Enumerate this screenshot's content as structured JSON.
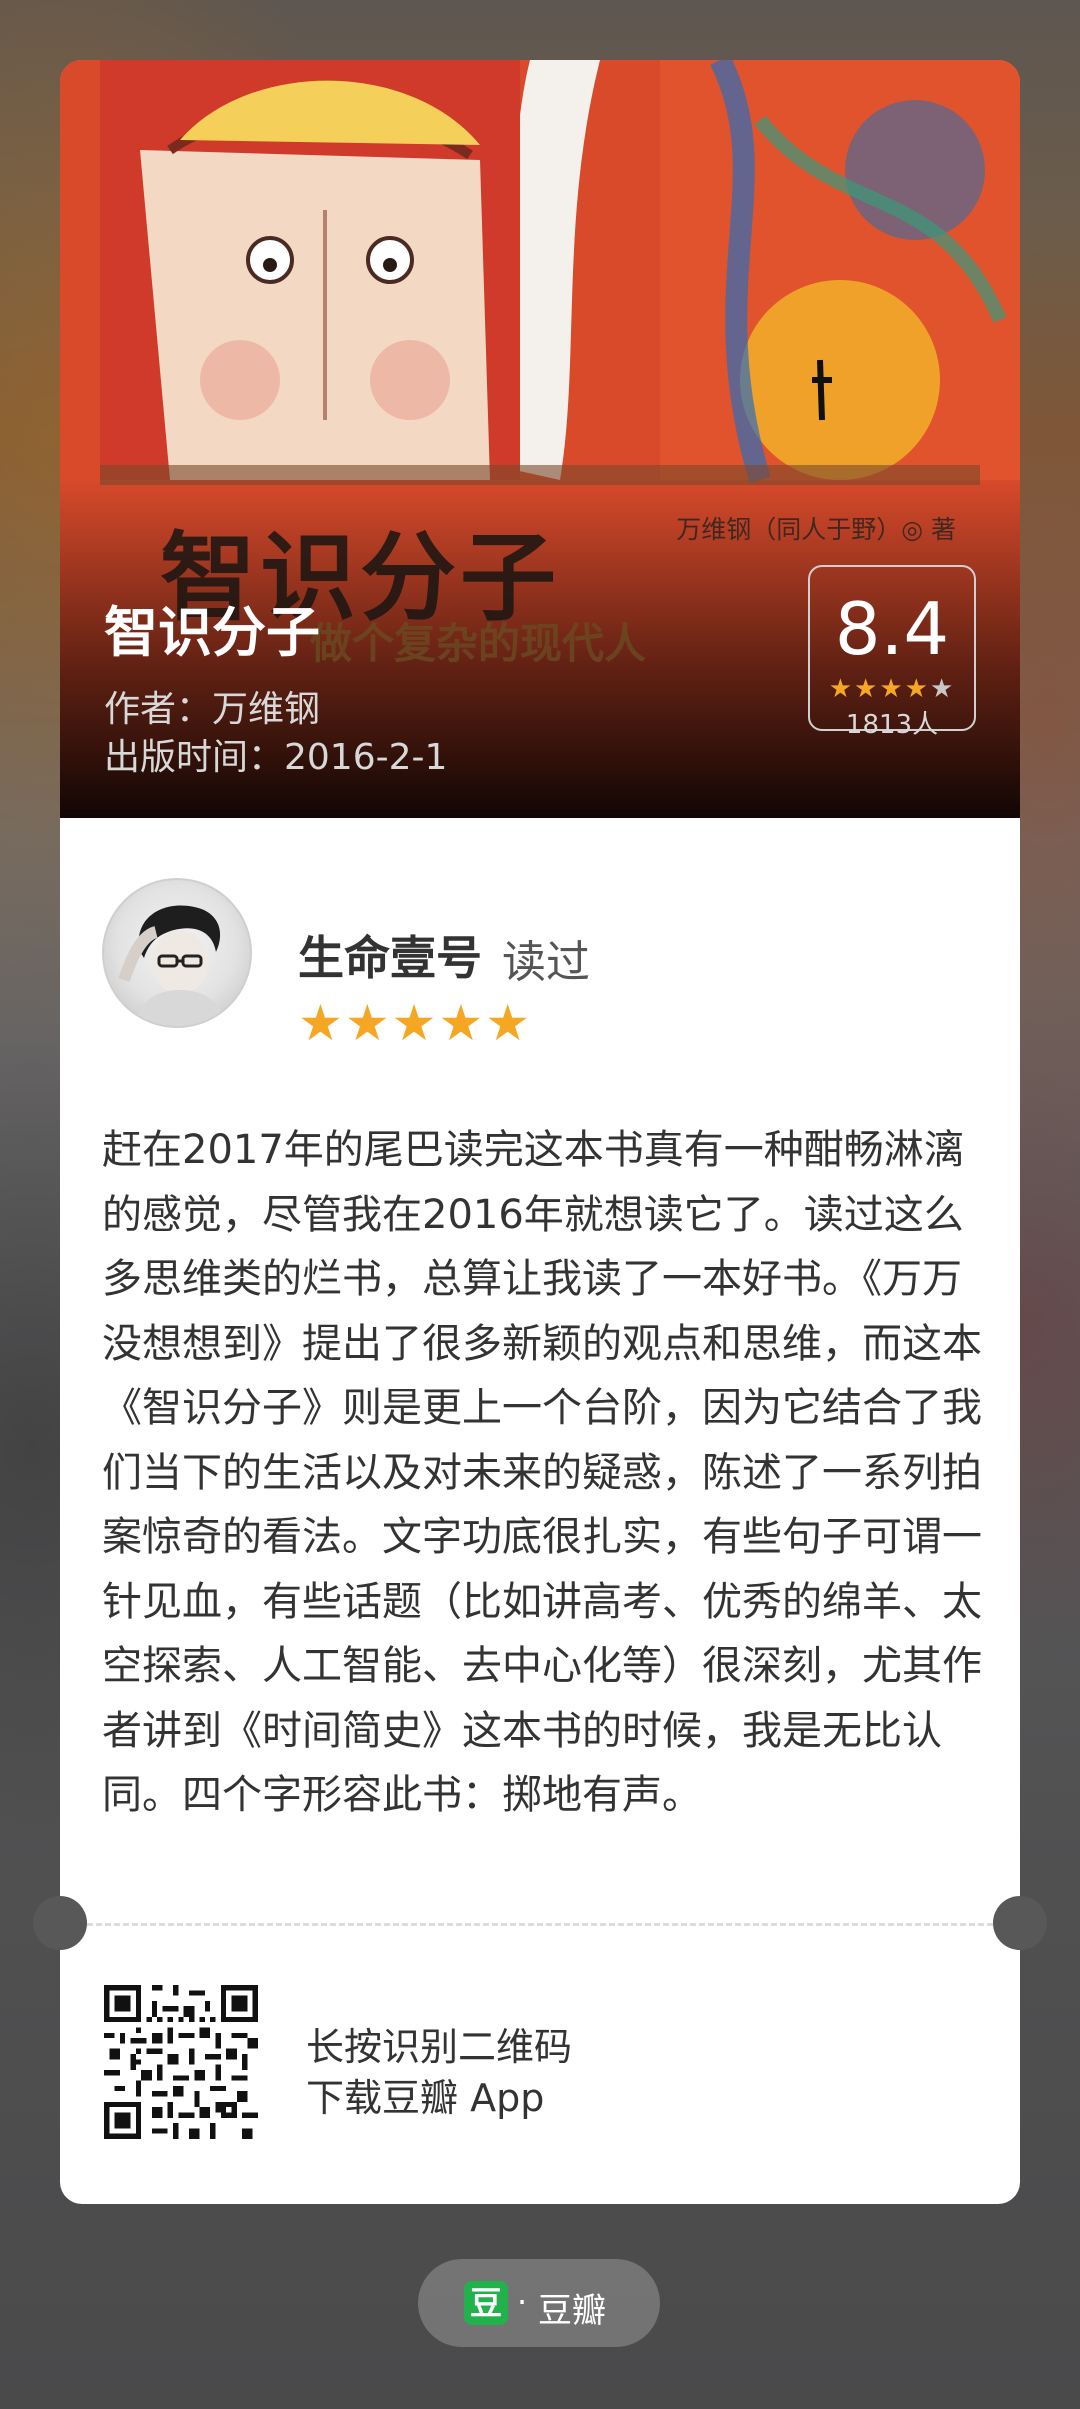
{
  "book": {
    "title": "智识分子",
    "author": "作者：万维钢",
    "publish_date": "出版时间：2016-2-1",
    "cover_art": {
      "title": "智识分子",
      "subtitle": "做个复杂的现代人",
      "author": "万维钢（同人于野）◎ 著"
    }
  },
  "rating": {
    "score": "8.4",
    "stars_filled": 4,
    "stars_total": 5,
    "count": "1813人",
    "star_color": "#f5a623"
  },
  "review": {
    "user_name": "生命壹号",
    "action": "读过",
    "stars": "★★★★★",
    "stars_value": 5,
    "text": "赶在2017年的尾巴读完这本书真有一种酣畅淋漓的感觉，尽管我在2016年就想读它了。读过这么多思维类的烂书，总算让我读了一本好书。《万万没想想到》提出了很多新颖的观点和思维，而这本《智识分子》则是更上一个台阶，因为它结合了我们当下的生活以及对未来的疑惑，陈述了一系列拍案惊奇的看法。文字功底很扎实，有些句子可谓一针见血，有些话题（比如讲高考、优秀的绵羊、太空探索、人工智能、去中心化等）很深刻，尤其作者讲到《时间简史》这本书的时候，我是无比认同。四个字形容此书：掷地有声。"
  },
  "footer": {
    "qr_line1": "长按识别二维码",
    "qr_line2": "下载豆瓣 App"
  },
  "brand": {
    "logo_char": "豆",
    "separator": "·",
    "name": "豆瓣",
    "logo_color": "#22b24c"
  }
}
